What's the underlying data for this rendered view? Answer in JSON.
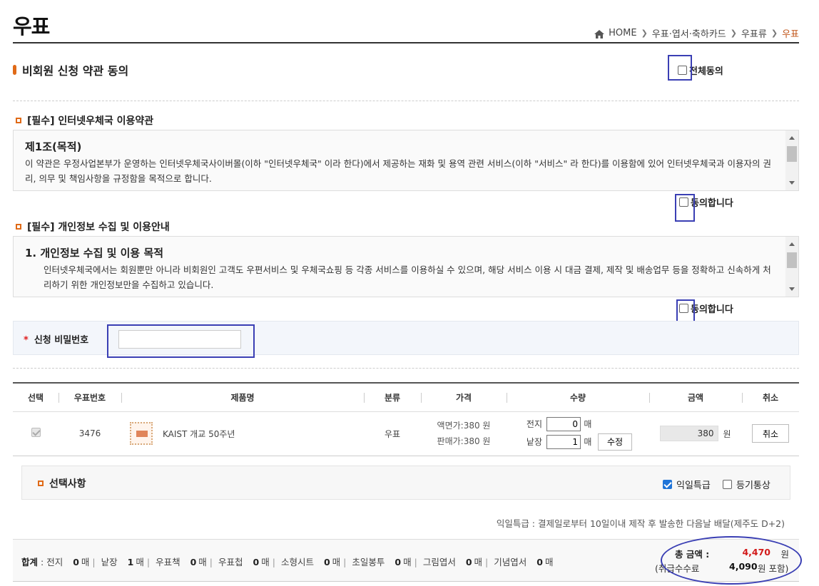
{
  "page": {
    "title": "우표"
  },
  "breadcrumb": {
    "items": [
      "HOME",
      "우표·엽서·축하카드",
      "우표류"
    ],
    "current": "우표"
  },
  "section": {
    "title": "비회원 신청 약관 동의",
    "agree_all_label": "전체동의"
  },
  "terms": [
    {
      "heading": "[필수] 인터넷우체국 이용약관",
      "body_title": "제1조(목적)",
      "body_text": "이 약관은 우정사업본부가 운영하는 인터넷우체국사이버몰(이하 \"인터넷우체국\" 이라 한다)에서 제공하는 재화 및 용역 관련 서비스(이하 \"서비스\" 라 한다)를 이용함에 있어 인터넷우체국과 이용자의 권리, 의무 및 책임사항을 규정함을 목적으로 합니다.",
      "agree_label": "동의합니다"
    },
    {
      "heading": "[필수] 개인정보 수집 및 이용안내",
      "body_title": "1. 개인정보 수집 및 이용 목적",
      "body_text": "인터넷우체국에서는 회원뿐만 아니라 비회원인 고객도 우편서비스 및 우체국쇼핑 등 각종 서비스를 이용하실 수 있으며, 해당 서비스 이용 시 대금 결제, 제작 및 배송업무 등을 정확하고 신속하게 처리하기 위한 개인정보만을 수집하고 있습니다.",
      "agree_label": "동의합니다"
    }
  ],
  "password": {
    "required_mark": "*",
    "label": "신청 비밀번호",
    "value": ""
  },
  "table": {
    "headers": [
      "선택",
      "우표번호",
      "제품명",
      "분류",
      "가격",
      "수량",
      "금액",
      "취소"
    ],
    "row": {
      "number": "3476",
      "name": "KAIST 개교 50주년",
      "category": "우표",
      "face_price": "액면가:380 원",
      "sale_price": "판매가:380 원",
      "qty_sheet_label": "전지",
      "qty_sheet": "0",
      "qty_single_label": "낱장",
      "qty_single": "1",
      "unit": "매",
      "edit_label": "수정",
      "amount": "380",
      "amount_unit": "원",
      "cancel_label": "취소"
    }
  },
  "options": {
    "title": "선택사항",
    "opt1": {
      "label": "익일특급",
      "checked": true
    },
    "opt2": {
      "label": "등기통상",
      "checked": false
    },
    "note": "익일특급 : 결제일로부터 10일이내 제작 후 발송한 다음날 배달(제주도 D+2)"
  },
  "summary": {
    "label": "합계",
    "items": [
      {
        "name": "전지",
        "count": "0",
        "unit": "매"
      },
      {
        "name": "낱장",
        "count": "1",
        "unit": "매"
      },
      {
        "name": "우표책",
        "count": "0",
        "unit": "매"
      },
      {
        "name": "우표첩",
        "count": "0",
        "unit": "매"
      },
      {
        "name": "소형시트",
        "count": "0",
        "unit": "매"
      },
      {
        "name": "초일봉투",
        "count": "0",
        "unit": "매"
      },
      {
        "name": "그림엽서",
        "count": "0",
        "unit": "매"
      },
      {
        "name": "기념엽서",
        "count": "0",
        "unit": "매"
      }
    ],
    "total_label": "총 금액 :",
    "total_value": "4,470",
    "total_unit": "원",
    "fee_prefix": "(취급수수료",
    "fee_value": "4,090",
    "fee_suffix": "원 포함)"
  },
  "colors": {
    "accent": "#e06a17",
    "highlight": "#3a3fb4",
    "total": "#d21b1b"
  }
}
